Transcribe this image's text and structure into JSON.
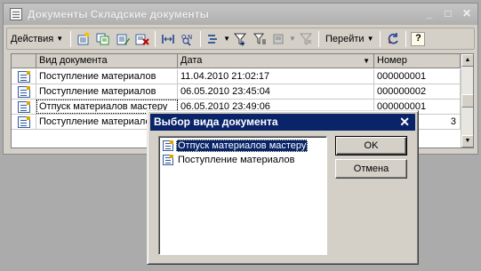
{
  "window": {
    "title": "Документы Складские документы",
    "controls": {
      "minimize": "_",
      "maximize": "□",
      "close": "✕"
    }
  },
  "toolbar": {
    "actions_label": "Действия",
    "goto_label": "Перейти",
    "help_label": "?",
    "icons": [
      "add-icon",
      "copy-icon",
      "edit-icon",
      "delete-icon",
      "period-icon",
      "find-icon",
      "struct-icon",
      "filter-icon",
      "filter-list-icon",
      "filter-mgr-icon",
      "filter-off-icon",
      "refresh-icon",
      "help-icon"
    ]
  },
  "table": {
    "columns": [
      "Вид документа",
      "Дата",
      "Номер"
    ],
    "rows": [
      {
        "type": "Поступление материалов",
        "date": "11.04.2010 21:02:17",
        "number": "000000001"
      },
      {
        "type": "Поступление материалов",
        "date": "06.05.2010 23:45:04",
        "number": "000000002"
      },
      {
        "type": "Отпуск материалов мастеру",
        "date": "06.05.2010 23:49:06",
        "number": "000000001"
      },
      {
        "type": "Поступление материалов",
        "date": "",
        "number": "3"
      }
    ],
    "selected_row": 2
  },
  "dialog": {
    "title": "Выбор вида документа",
    "close": "✕",
    "items": [
      "Отпуск материалов мастеру",
      "Поступление материалов"
    ],
    "selected_item": 0,
    "ok_label": "OK",
    "cancel_label": "Отмена"
  },
  "colors": {
    "dialog_title_bg": "#0a246a",
    "selection_bg": "#0a246a",
    "window_bg": "#d4d0c8"
  }
}
